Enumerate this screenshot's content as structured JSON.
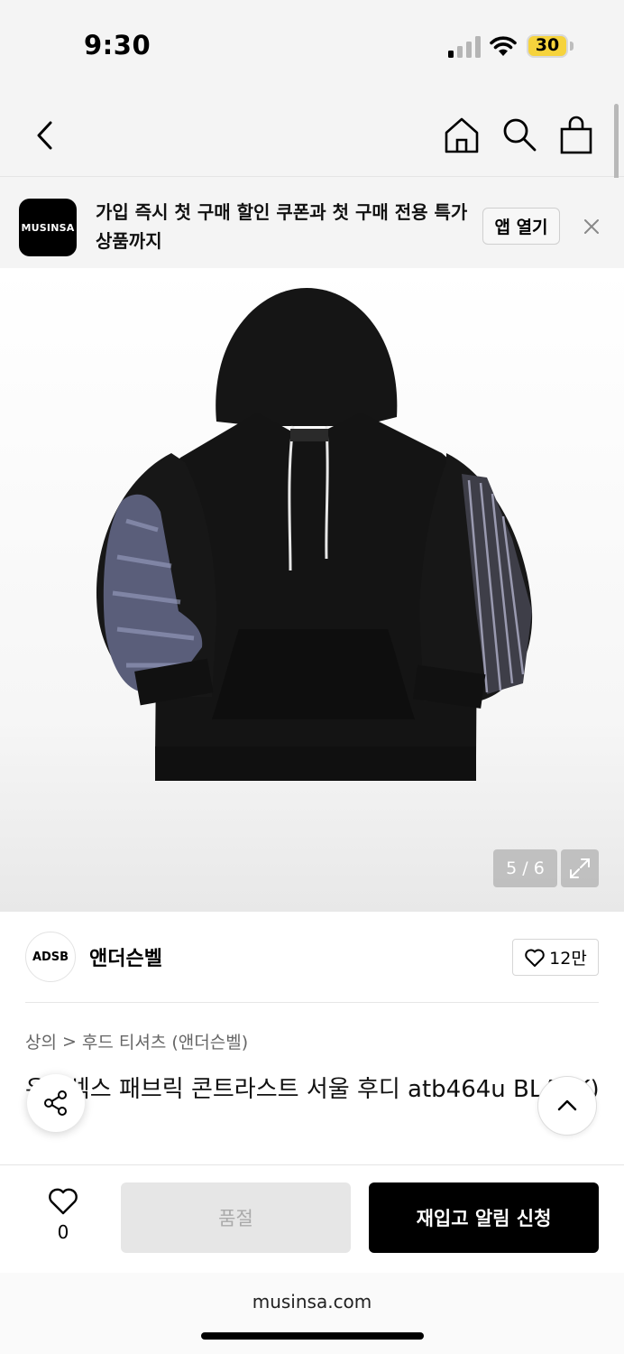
{
  "status_bar": {
    "time": "9:30",
    "battery": "30"
  },
  "promo": {
    "logo": "MUSINSA",
    "text": "가입 즉시 첫 구매 할인 쿠폰과 첫 구매 전용 특가 상품까지",
    "open_label": "앱 열기"
  },
  "gallery": {
    "counter": "5 / 6"
  },
  "brand": {
    "logo_text": "ADSB",
    "name": "앤더슨벨",
    "likes": "12만"
  },
  "breadcrumb": {
    "category": "상의",
    "separator": ">",
    "subcategory": "후드 티셔츠 (앤더슨벨)"
  },
  "product": {
    "title": "유니섹스 패브릭 콘트라스트 서울 후디 atb464u BLACK)"
  },
  "actions": {
    "wish_count": "0",
    "soldout_label": "품절",
    "restock_label": "재입고 알림 신청"
  },
  "footer": {
    "url": "musinsa.com"
  },
  "colors": {
    "brand_black": "#000000",
    "battery_yellow": "#f6d33c"
  },
  "icons": [
    "back-icon",
    "home-icon",
    "search-icon",
    "bag-icon",
    "close-icon",
    "expand-icon",
    "heart-icon",
    "share-icon",
    "chevron-up-icon"
  ]
}
